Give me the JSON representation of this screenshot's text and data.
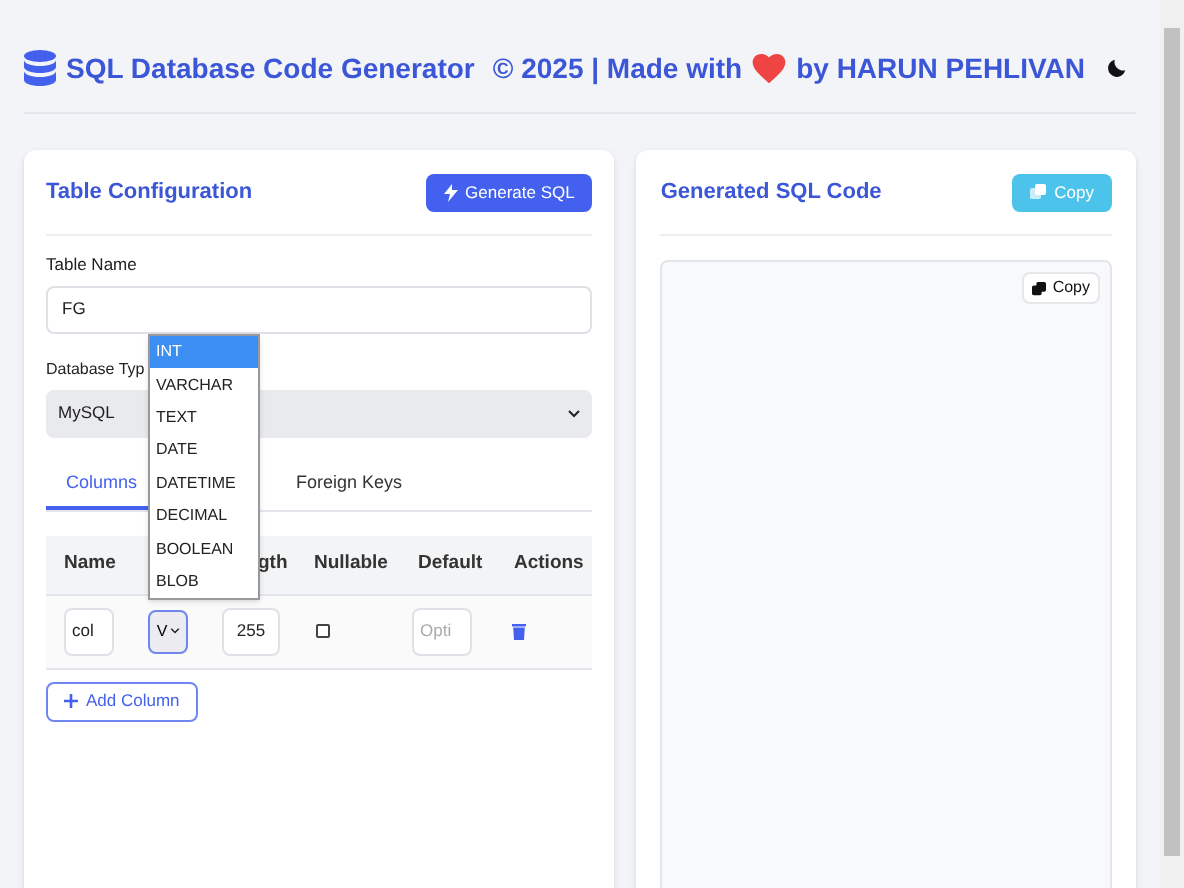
{
  "header": {
    "title": "SQL Database Code Generator",
    "credit_before": "© 2025 | Made with",
    "credit_after": "by HARUN PEHLIVAN"
  },
  "config": {
    "title": "Table Configuration",
    "generate_button": "Generate SQL",
    "table_name": {
      "label": "Table Name",
      "value": "FG"
    },
    "database_type": {
      "label": "Database Typ",
      "value": "MySQL"
    },
    "type_dropdown": [
      {
        "label": "INT",
        "selected": true
      },
      {
        "label": "VARCHAR",
        "selected": false
      },
      {
        "label": "TEXT",
        "selected": false
      },
      {
        "label": "DATE",
        "selected": false
      },
      {
        "label": "DATETIME",
        "selected": false
      },
      {
        "label": "DECIMAL",
        "selected": false
      },
      {
        "label": "BOOLEAN",
        "selected": false
      },
      {
        "label": "BLOB",
        "selected": false
      }
    ],
    "tabs": [
      {
        "label": "Columns",
        "selected": true
      },
      {
        "label": "Foreign Keys",
        "selected": false
      }
    ],
    "table": {
      "columns": [
        "Name",
        "gth",
        "Nullable",
        "Default",
        "Actions"
      ],
      "rows": [
        {
          "name": "col",
          "type": "V",
          "length": "255",
          "nullable": false,
          "default_placeholder": "Opti"
        }
      ]
    },
    "add_button": "Add Column"
  },
  "output": {
    "title": "Generated SQL Code",
    "copy_button": "Copy",
    "inner_copy_button": "Copy"
  }
}
